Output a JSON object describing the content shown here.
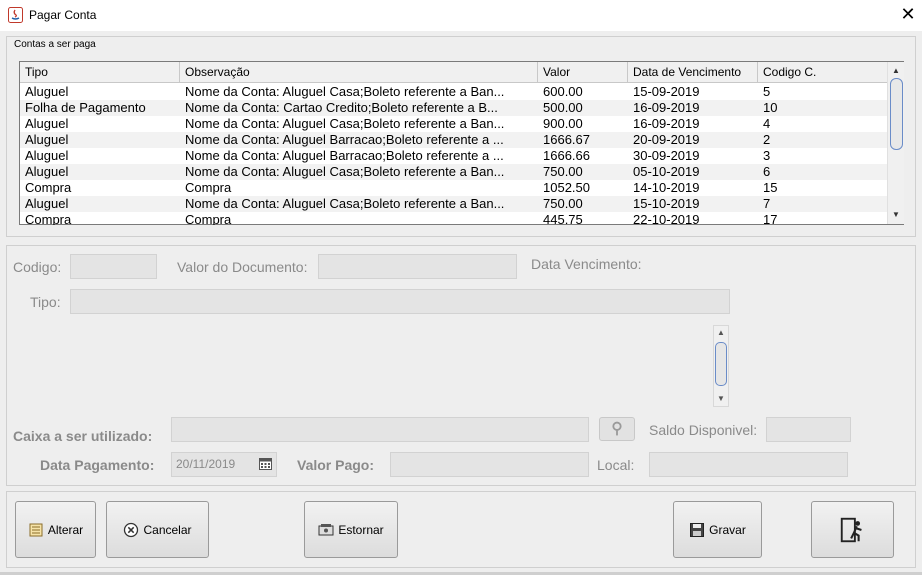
{
  "window": {
    "title": "Pagar Conta",
    "close_glyph": "✕",
    "app_icon": "java-icon"
  },
  "table_panel": {
    "legend": "Contas a ser paga",
    "columns": [
      "Tipo",
      "Observação",
      "Valor",
      "Data de Vencimento",
      "Codigo C."
    ],
    "rows": [
      [
        "Aluguel",
        "Nome da Conta: Aluguel Casa;Boleto referente a Ban...",
        "600.00",
        "15-09-2019",
        "5"
      ],
      [
        "Folha de Pagamento",
        "Nome da Conta: Cartao Credito;Boleto referente a B...",
        "500.00",
        "16-09-2019",
        "10"
      ],
      [
        "Aluguel",
        "Nome da Conta: Aluguel Casa;Boleto referente a Ban...",
        "900.00",
        "16-09-2019",
        "4"
      ],
      [
        "Aluguel",
        "Nome da Conta: Aluguel Barracao;Boleto referente a ...",
        "1666.67",
        "20-09-2019",
        "2"
      ],
      [
        "Aluguel",
        "Nome da Conta: Aluguel Barracao;Boleto referente a ...",
        "1666.66",
        "30-09-2019",
        "3"
      ],
      [
        "Aluguel",
        "Nome da Conta: Aluguel Casa;Boleto referente a Ban...",
        "750.00",
        "05-10-2019",
        "6"
      ],
      [
        "Compra",
        "Compra",
        "1052.50",
        "14-10-2019",
        "15"
      ],
      [
        "Aluguel",
        "Nome da Conta: Aluguel Casa;Boleto referente a Ban...",
        "750.00",
        "15-10-2019",
        "7"
      ],
      [
        "Compra",
        "Compra",
        "445.75",
        "22-10-2019",
        "17"
      ]
    ]
  },
  "form": {
    "codigo_label": "Codigo:",
    "valor_documento_label": "Valor do Documento:",
    "data_vencimento_label": "Data Vencimento:",
    "tipo_label": "Tipo:",
    "caixa_label": "Caixa a ser utilizado:",
    "saldo_label": "Saldo Disponivel:",
    "data_pagamento_label": "Data Pagamento:",
    "data_pagamento_value": "20/11/2019",
    "valor_pago_label": "Valor Pago:",
    "local_label": "Local:"
  },
  "buttons": {
    "alterar": "Alterar",
    "cancelar": "Cancelar",
    "estornar": "Estornar",
    "gravar": "Gravar"
  }
}
